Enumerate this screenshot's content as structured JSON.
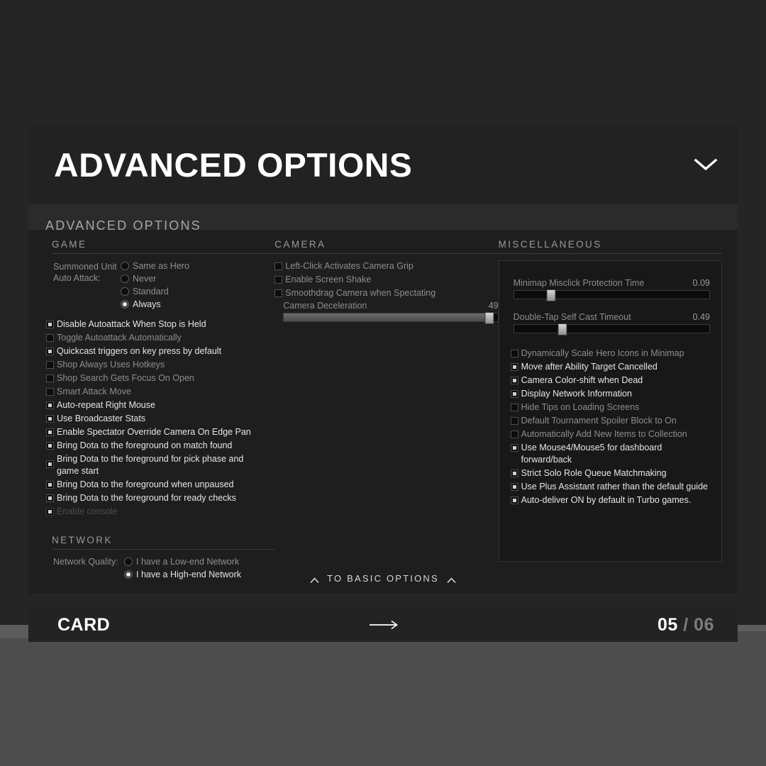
{
  "header": {
    "title": "ADVANCED OPTIONS",
    "collapse_icon": "chevron-down-icon"
  },
  "panel": {
    "heading": "ADVANCED OPTIONS",
    "to_basic_label": "TO BASIC OPTIONS",
    "caret_icon": "chevron-up-icon"
  },
  "game": {
    "section_title": "GAME",
    "auto_attack_label": "Summoned Unit Auto Attack:",
    "auto_attack_options": [
      {
        "label": "Same as Hero",
        "selected": false,
        "bright": false
      },
      {
        "label": "Never",
        "selected": false,
        "bright": false
      },
      {
        "label": "Standard",
        "selected": false,
        "bright": false
      },
      {
        "label": "Always",
        "selected": true,
        "bright": true
      }
    ],
    "checkboxes": [
      {
        "label": "Disable Autoattack When Stop is Held",
        "checked": true,
        "state": "bright"
      },
      {
        "label": "Toggle Autoattack Automatically",
        "checked": false,
        "state": "normal"
      },
      {
        "label": "Quickcast triggers on key press by default",
        "checked": true,
        "state": "bright"
      },
      {
        "label": "Shop Always Uses Hotkeys",
        "checked": false,
        "state": "normal"
      },
      {
        "label": "Shop Search Gets Focus On Open",
        "checked": false,
        "state": "normal"
      },
      {
        "label": "Smart Attack Move",
        "checked": false,
        "state": "normal"
      },
      {
        "label": "Auto-repeat Right Mouse",
        "checked": true,
        "state": "bright"
      },
      {
        "label": "Use Broadcaster Stats",
        "checked": true,
        "state": "bright"
      },
      {
        "label": "Enable Spectator Override Camera On Edge Pan",
        "checked": true,
        "state": "bright"
      },
      {
        "label": "Bring Dota to the foreground on match found",
        "checked": true,
        "state": "bright"
      },
      {
        "label": "Bring Dota to the foreground for pick phase and game start",
        "checked": true,
        "state": "bright"
      },
      {
        "label": "Bring Dota to the foreground when unpaused",
        "checked": true,
        "state": "bright"
      },
      {
        "label": "Bring Dota to the foreground for ready checks",
        "checked": true,
        "state": "bright"
      },
      {
        "label": "Enable console",
        "checked": true,
        "state": "faint"
      }
    ]
  },
  "network": {
    "section_title": "NETWORK",
    "quality_label": "Network Quality:",
    "options": [
      {
        "label": "I have a Low-end Network",
        "selected": false
      },
      {
        "label": "I have a High-end Network",
        "selected": true
      }
    ]
  },
  "camera": {
    "section_title": "CAMERA",
    "checkboxes": [
      {
        "label": "Left-Click Activates Camera Grip",
        "checked": false,
        "state": "normal"
      },
      {
        "label": "Enable Screen Shake",
        "checked": false,
        "state": "normal"
      },
      {
        "label": "Smoothdrag Camera when Spectating",
        "checked": false,
        "state": "normal"
      }
    ],
    "slider": {
      "label": "Camera Deceleration",
      "value": "49",
      "percent": 96
    }
  },
  "miscellaneous": {
    "section_title": "MISCELLANEOUS",
    "sliders": [
      {
        "label": "Minimap Misclick Protection Time",
        "value": "0.09",
        "percent": 19
      },
      {
        "label": "Double-Tap Self Cast Timeout",
        "value": "0.49",
        "percent": 25
      }
    ],
    "checkboxes": [
      {
        "label": "Dynamically Scale Hero Icons in Minimap",
        "checked": false,
        "state": "normal"
      },
      {
        "label": "Move after Ability Target Cancelled",
        "checked": true,
        "state": "bright"
      },
      {
        "label": "Camera Color-shift when Dead",
        "checked": true,
        "state": "bright"
      },
      {
        "label": "Display Network Information",
        "checked": true,
        "state": "bright"
      },
      {
        "label": "Hide Tips on Loading Screens",
        "checked": false,
        "state": "normal"
      },
      {
        "label": "Default Tournament Spoiler Block to On",
        "checked": false,
        "state": "normal"
      },
      {
        "label": "Automatically Add New Items to Collection",
        "checked": false,
        "state": "normal"
      },
      {
        "label": "Use Mouse4/Mouse5 for dashboard forward/back",
        "checked": true,
        "state": "bright"
      },
      {
        "label": "Strict Solo Role Queue Matchmaking",
        "checked": true,
        "state": "bright"
      },
      {
        "label": "Use Plus Assistant rather than the default guide",
        "checked": true,
        "state": "bright"
      },
      {
        "label": "Auto-deliver ON by default in Turbo games.",
        "checked": true,
        "state": "bright"
      }
    ]
  },
  "footer": {
    "label": "CARD",
    "arrow_icon": "arrow-right-icon",
    "current_page": "05",
    "separator": "/",
    "total_pages": "06"
  },
  "colors": {
    "card_header_bg": "#222222",
    "body_bg": "#1e1e1e",
    "footer_bg": "#232323",
    "page_bg": "#4d4d4d",
    "text_bright": "#e6e6e6",
    "text_normal": "#8d8d8d",
    "text_faint": "#4e4e4e"
  }
}
